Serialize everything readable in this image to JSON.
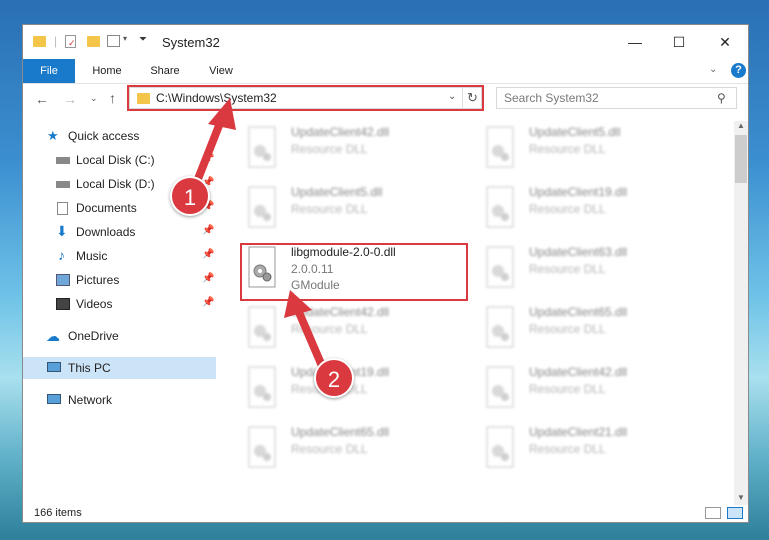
{
  "window": {
    "title": "System32",
    "controls": {
      "minimize": "—",
      "maximize": "☐",
      "close": "✕"
    }
  },
  "ribbon": {
    "tabs": [
      "File",
      "Home",
      "Share",
      "View"
    ],
    "help": "?"
  },
  "address_bar": {
    "path": "C:\\Windows\\System32",
    "search_placeholder": "Search System32"
  },
  "sidebar": {
    "items": [
      {
        "label": "Quick access"
      },
      {
        "label": "Local Disk (C:)"
      },
      {
        "label": "Local Disk (D:)"
      },
      {
        "label": "Documents"
      },
      {
        "label": "Downloads"
      },
      {
        "label": "Music"
      },
      {
        "label": "Pictures"
      },
      {
        "label": "Videos"
      },
      {
        "label": "OneDrive"
      },
      {
        "label": "This PC"
      },
      {
        "label": "Network"
      }
    ]
  },
  "files": [
    {
      "name": "UpdateClient42.dll",
      "desc": "Resource DLL"
    },
    {
      "name": "UpdateClient5.dll",
      "desc": "Resource DLL"
    },
    {
      "name": "UpdateClient5.dll",
      "desc": "Resource DLL"
    },
    {
      "name": "UpdateClient19.dll",
      "desc": "Resource DLL"
    },
    {
      "name": "libgmodule-2.0-0.dll",
      "version": "2.0.0.11",
      "desc": "GModule"
    },
    {
      "name": "UpdateClient63.dll",
      "desc": "Resource DLL"
    },
    {
      "name": "UpdateClient42.dll",
      "desc": "Resource DLL"
    },
    {
      "name": "UpdateClient65.dll",
      "desc": "Resource DLL"
    },
    {
      "name": "UpdateClient19.dll",
      "desc": "Resource DLL"
    },
    {
      "name": "UpdateClient42.dll",
      "desc": "Resource DLL"
    },
    {
      "name": "UpdateClient65.dll",
      "desc": "Resource DLL"
    },
    {
      "name": "UpdateClient21.dll",
      "desc": "Resource DLL"
    }
  ],
  "status": {
    "item_count": "166 items"
  },
  "callouts": {
    "one": "1",
    "two": "2"
  },
  "colors": {
    "accent": "#1979ca",
    "highlight": "#d9393f",
    "folder": "#f3c548"
  }
}
